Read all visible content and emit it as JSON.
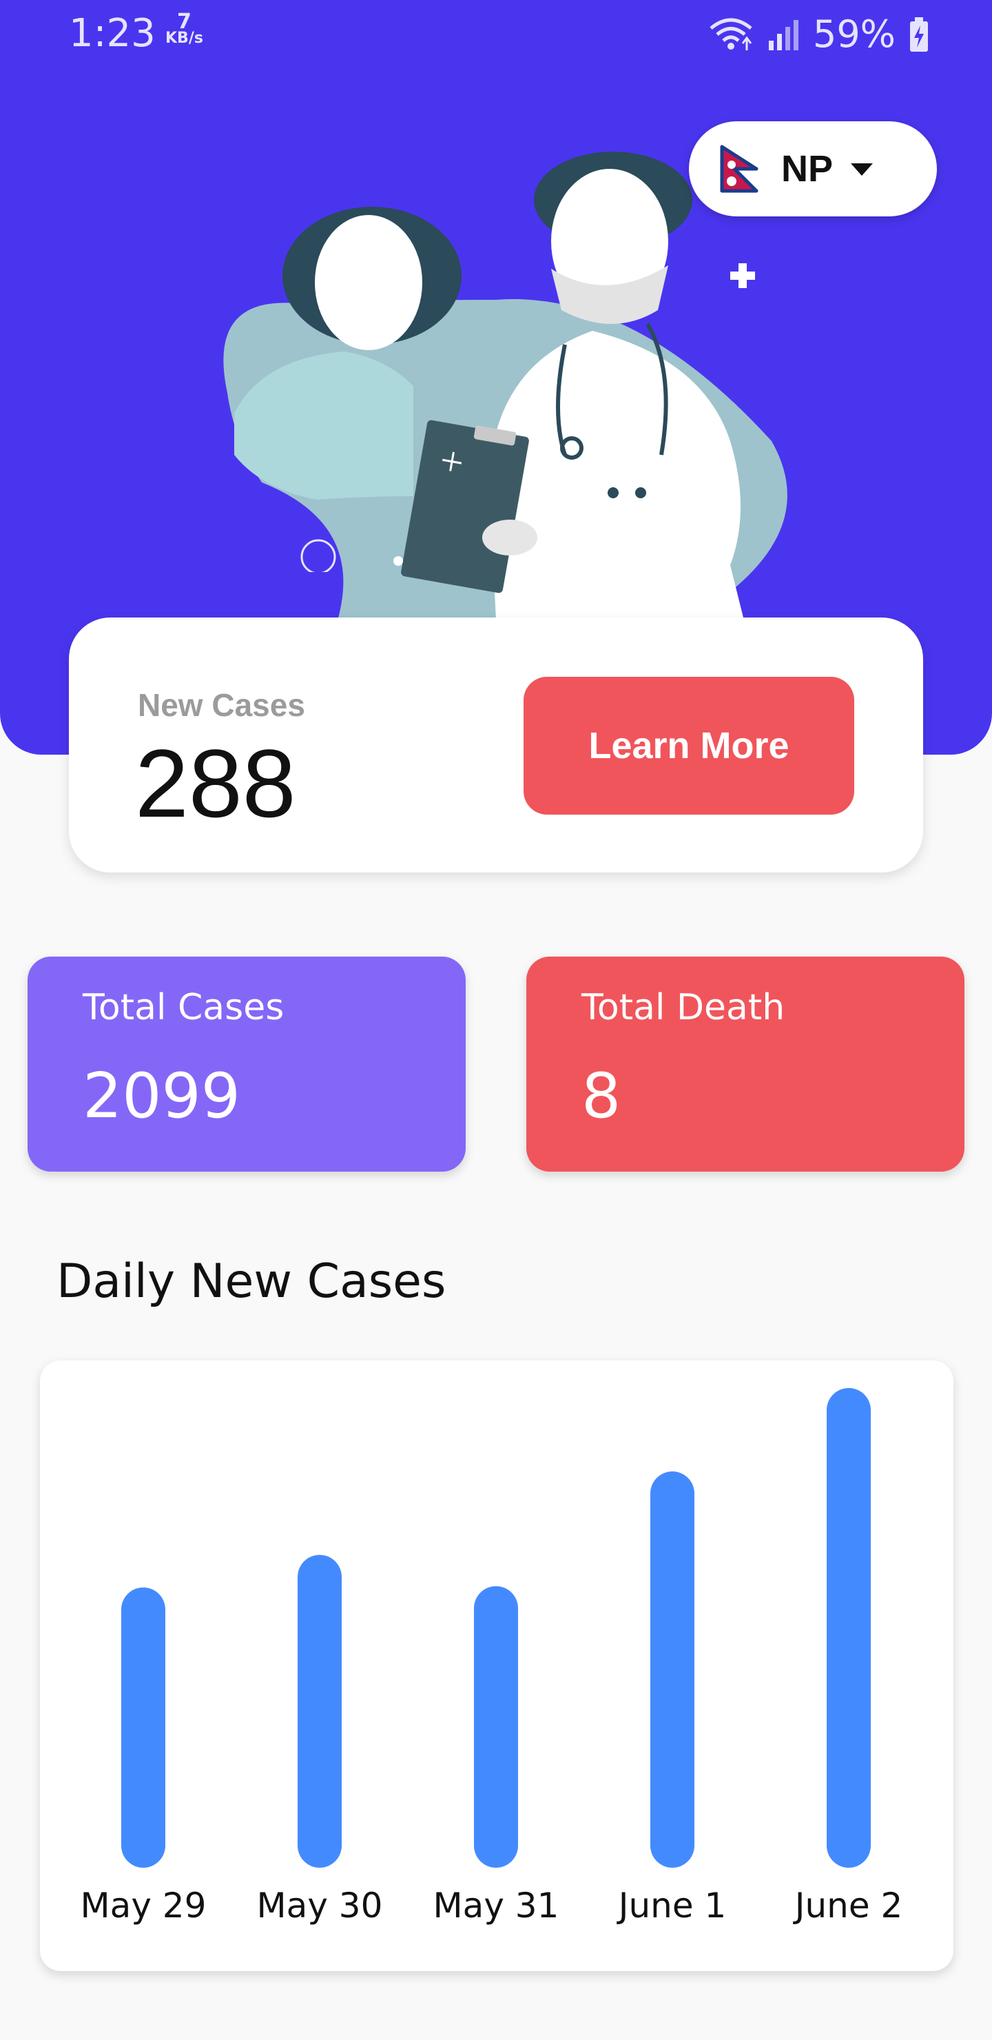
{
  "status_bar": {
    "time": "1:23",
    "speed_value": "7",
    "speed_unit": "KB/s",
    "battery": "59%"
  },
  "country": {
    "code": "NP",
    "flag_icon": "nepal-flag-icon"
  },
  "new_cases": {
    "label": "New Cases",
    "value": "288",
    "button_label": "Learn More"
  },
  "stats": [
    {
      "label": "Total Cases",
      "value": "2099"
    },
    {
      "label": "Total Death",
      "value": "8"
    }
  ],
  "section_title": "Daily New Cases",
  "colors": {
    "hero": "#4a35ef",
    "accent_red": "#f0555b",
    "accent_purple": "#8467f7",
    "bar": "#448aff"
  },
  "chart_data": {
    "type": "bar",
    "categories": [
      "May 29",
      "May 30",
      "May 31",
      "June 1",
      "June 2"
    ],
    "values": [
      215,
      240,
      216,
      304,
      368
    ],
    "ylim": [
      0,
      368
    ],
    "grid": false,
    "title": "",
    "xlabel": "",
    "ylabel": ""
  }
}
